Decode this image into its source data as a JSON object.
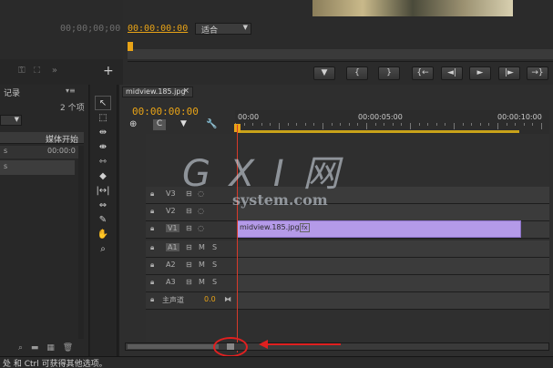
{
  "program_monitor": {
    "left_timecode": "00;00;00;00",
    "current_timecode": "00:00:00:00",
    "fit_select": "适合",
    "fit_arrow": "▼",
    "controls": [
      "▼",
      "{",
      "}",
      "{←",
      "◄|",
      "►",
      "|►",
      "→}"
    ]
  },
  "project_panel": {
    "tab": "记录",
    "menu_icon": "▾≡",
    "item_count": "2 个项",
    "media_start_header": "媒体开始",
    "row_timecode": "00:00:0",
    "row_labels": [
      "s",
      "s"
    ],
    "footer_icons": [
      "⌕",
      "▬",
      "▦",
      "🗑"
    ]
  },
  "timeline": {
    "tab_label": "midview.185.jpg",
    "close_icon": "×",
    "timecode": "00:00:00:00",
    "ruler_labels": [
      "00:00",
      "00:00:05:00",
      "00:00:10:00"
    ],
    "video_tracks": [
      "V3",
      "V2",
      "V1"
    ],
    "audio_tracks": [
      "A1",
      "A2",
      "A3"
    ],
    "master_track": "主声道",
    "master_value": "0.0",
    "clip_label": "midview.185.jpg",
    "clip_fx": "fx",
    "track_m": "M",
    "track_s": "S"
  },
  "status_bar": {
    "text": "处 和 Ctrl 可获得其他选项。"
  },
  "watermark": {
    "main": "G X I 网",
    "sub": "system.com"
  },
  "colors": {
    "timecode": "#e8a317",
    "clip": "#b49ae8",
    "playhead": "#d63a2a",
    "annotation": "#e02020"
  }
}
